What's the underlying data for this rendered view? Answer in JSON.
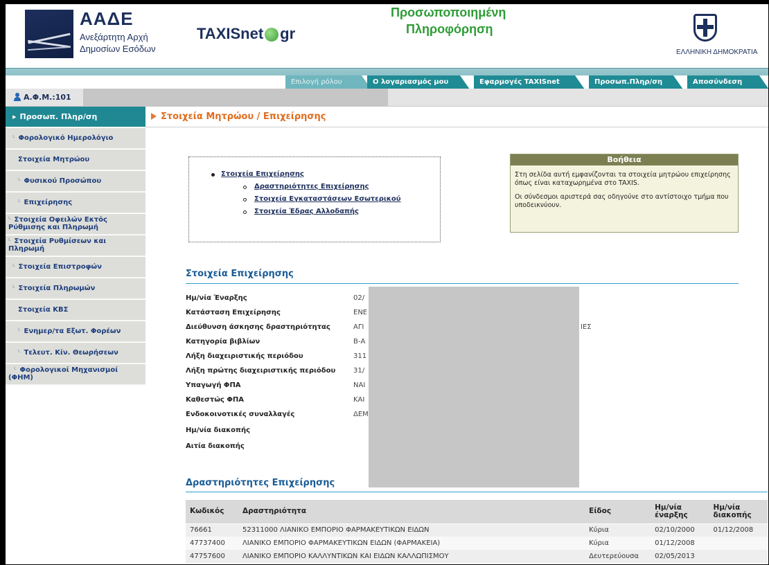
{
  "header": {
    "aade_title": "ΑΑΔΕ",
    "aade_sub1": "Ανεξάρτητη Αρχή",
    "aade_sub2": "Δημοσίων Εσόδων",
    "taxis_left": "TAXISnet",
    "taxis_right": "gr",
    "perso_line1": "Προσωποποιημένη",
    "perso_line2": "Πληροφόρηση",
    "republic": "ΕΛΛΗΝΙΚΗ ΔΗΜΟΚΡΑΤΙΑ"
  },
  "nav": {
    "tabs": [
      {
        "label": "Επιλογή ρόλου"
      },
      {
        "label": "Ο λογαριασμός μου"
      },
      {
        "label": "Εφαρμογές TAXISnet"
      },
      {
        "label": "Προσωπ.Πληρ/ση"
      },
      {
        "label": "Αποσύνδεση"
      }
    ]
  },
  "afm": {
    "label": "Α.Φ.Μ.:101"
  },
  "sidebar": {
    "items": [
      {
        "label": "Προσωπ. Πληρ/ση"
      },
      {
        "label": "Φορολογικό Ημερολόγιο"
      },
      {
        "label": "Στοιχεία Μητρώου"
      },
      {
        "label": "Φυσικού Προσώπου"
      },
      {
        "label": "Επιχείρησης"
      },
      {
        "label1": "Στοιχεία Οφειλών Εκτός",
        "label2": "Ρύθμισης και Πληρωμή"
      },
      {
        "label1": "Στοιχεία Ρυθμίσεων και",
        "label2": "Πληρωμή"
      },
      {
        "label": "Στοιχεία Επιστροφών"
      },
      {
        "label": "Στοιχεία Πληρωμών"
      },
      {
        "label": "Στοιχεία ΚΒΣ"
      },
      {
        "label": "Ενημερ/τα Εξωτ. Φορέων"
      },
      {
        "label": "Τελευτ. Κίν. Θεωρήσεων"
      },
      {
        "label1": "Φορολογικοί Μηχανισμοί",
        "label2": "(ΦΗΜ)"
      }
    ]
  },
  "main": {
    "page_title": "Στοιχεία Μητρώου / Επιχείρησης",
    "links": {
      "top": "Στοιχεία Επιχείρησης",
      "sub": [
        "Δραστηριότητες Επιχείρησης",
        "Στοιχεία Εγκαταστάσεων Εσωτερικού",
        "Στοιχεία Έδρας Αλλοδαπής"
      ]
    },
    "help": {
      "title": "Βοήθεια",
      "p1": "Στη σελίδα αυτή εμφανίζονται τα στοιχεία μητρώου επιχείρησης όπως είναι καταχωρημένα στο TAXIS.",
      "p2": "Οι σύνδεσμοι αριστερά σας οδηγούνε στο αντίστοιχο τμήμα που υποδεικνύουν."
    },
    "business": {
      "title": "Στοιχεία Επιχείρησης",
      "fields": [
        {
          "label": "Ημ/νία Έναρξης",
          "value": "02/"
        },
        {
          "label": "Κατάσταση Επιχείρησης",
          "value": "ΕΝΕ"
        },
        {
          "label": "Διεύθυνση άσκησης δραστηριότητας",
          "value": "ΑΓΙ",
          "value_right": "ΙΕΣ"
        },
        {
          "label": "Κατηγορία βιβλίων",
          "value": "Β-Α"
        },
        {
          "label": "Λήξη διαχειριστικής περιόδου",
          "value": "311"
        },
        {
          "label": "Λήξη πρώτης διαχειριστικής περιόδου",
          "value": "31/"
        },
        {
          "label": "Υπαγωγή ΦΠΑ",
          "value": "ΝΑΙ"
        },
        {
          "label": "Καθεστώς ΦΠΑ",
          "value": "ΚΑΙ"
        },
        {
          "label": "Ενδοκοινοτικές συναλλαγές",
          "value": "ΔΕΜ"
        },
        {
          "label": "Ημ/νία διακοπής",
          "value": ""
        },
        {
          "label": "Αιτία διακοπής",
          "value": ""
        }
      ]
    },
    "activities": {
      "title": "Δραστηριότητες Επιχείρησης",
      "headers": {
        "code": "Κωδικός",
        "activity": "Δραστηριότητα",
        "kind": "Είδος",
        "start1": "Ημ/νία",
        "start2": "έναρξης",
        "end1": "Ημ/νία",
        "end2": "διακοπής"
      },
      "rows": [
        {
          "code": "76661",
          "activity": "52311000 ΛΙΑΝΙΚΟ ΕΜΠΟΡΙΟ ΦΑΡΜΑΚΕΥΤΙΚΩΝ ΕΙΔΩΝ",
          "kind": "Κύρια",
          "start": "02/10/2000",
          "end": "01/12/2008"
        },
        {
          "code": "47737400",
          "activity": "ΛΙΑΝΙΚΟ ΕΜΠΟΡΙΟ ΦΑΡΜΑΚΕΥΤΙΚΩΝ ΕΙΔΩΝ (ΦΑΡΜΑΚΕΙΑ)",
          "kind": "Κύρια",
          "start": "01/12/2008",
          "end": ""
        },
        {
          "code": "47757600",
          "activity": "ΛΙΑΝΙΚΟ ΕΜΠΟΡΙΟ ΚΑΛΛΥΝΤΙΚΩΝ ΚΑΙ ΕΙΔΩΝ ΚΑΛΛΩΠΙΣΜΟΥ",
          "kind": "Δευτερεύουσα",
          "start": "02/05/2013",
          "end": ""
        }
      ]
    }
  }
}
